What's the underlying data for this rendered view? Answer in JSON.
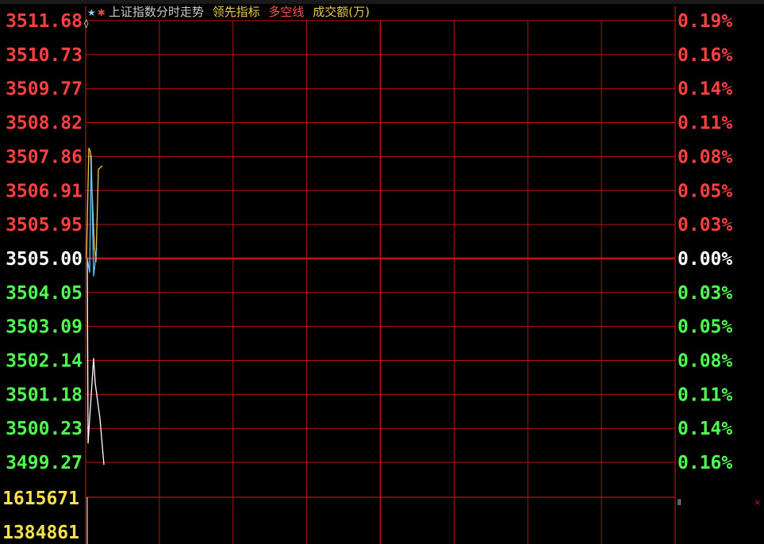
{
  "header": {
    "title": "上证指数分时走势",
    "indicator_lead": "领先指标",
    "indicator_longshort": "多空线",
    "indicator_volume": "成交额(万)",
    "star_icon": "star-icon",
    "gear_icon": "gear-icon"
  },
  "colors": {
    "grid": "#c01010",
    "up": "#ff4040",
    "down": "#50ff50",
    "base": "#ffffff",
    "volume_label": "#f5e050",
    "price_line": "#ffffff",
    "lead_line": "#e6c84a",
    "avg_line": "#60c8ff"
  },
  "chart_data": {
    "type": "line",
    "base_price": "3505.00",
    "price_ticks": [
      "3511.68",
      "3510.73",
      "3509.77",
      "3508.82",
      "3507.86",
      "3506.91",
      "3505.95",
      "3505.00",
      "3504.05",
      "3503.09",
      "3502.14",
      "3501.18",
      "3500.23",
      "3499.27"
    ],
    "pct_ticks": [
      "0.19%",
      "0.16%",
      "0.14%",
      "0.11%",
      "0.08%",
      "0.05%",
      "0.03%",
      "0.00%",
      "0.03%",
      "0.05%",
      "0.08%",
      "0.11%",
      "0.14%",
      "0.16%"
    ],
    "ylim": [
      3499.27,
      3511.68
    ],
    "volume_ticks": [
      "1615671",
      "1384861"
    ],
    "series": [
      {
        "values": [
          3505.0,
          3499.8,
          3502.2,
          3501.5,
          3500.5,
          3499.2
        ]
      },
      {
        "values": [
          3505.0,
          3508.1,
          3508.0,
          3505.3,
          3504.9,
          3507.5,
          3507.6
        ]
      },
      {
        "values": [
          3505.0,
          3504.6,
          3507.9,
          3504.5,
          3505.3
        ]
      }
    ]
  }
}
